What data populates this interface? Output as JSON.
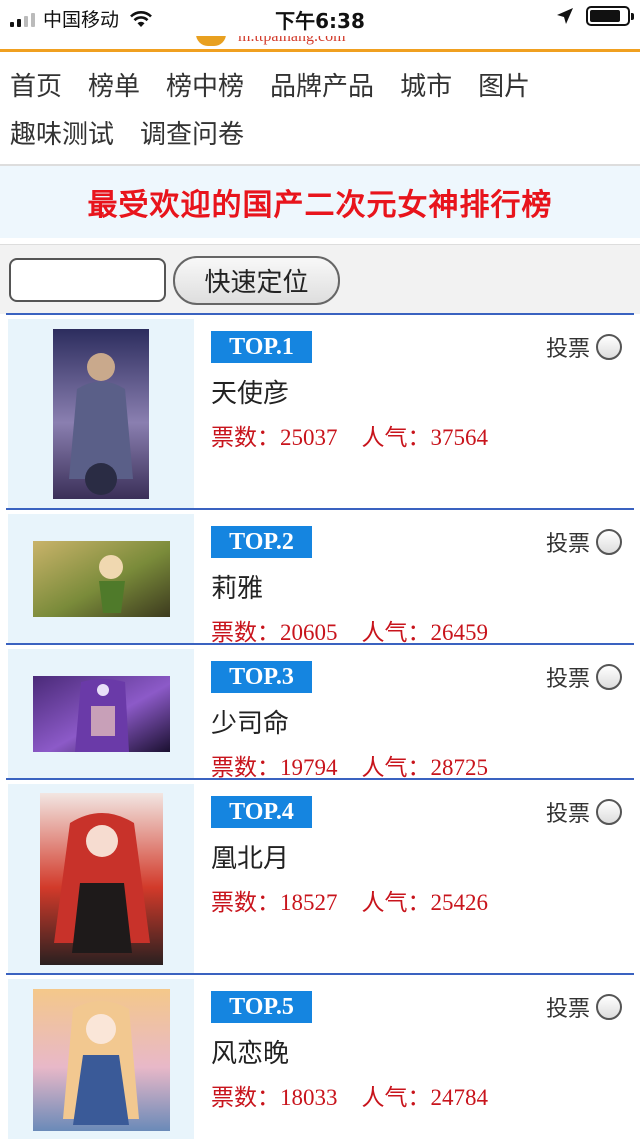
{
  "status_bar": {
    "carrier": "中国移动",
    "time": "下午6:38"
  },
  "header": {
    "logo_text": "m.ttpaihang.com"
  },
  "nav": {
    "row1": [
      "首页",
      "榜单",
      "榜中榜",
      "品牌产品",
      "城市",
      "图片"
    ],
    "row2": [
      "趣味测试",
      "调查问卷"
    ]
  },
  "page_title": "最受欢迎的国产二次元女神排行榜",
  "search": {
    "value": "",
    "button_label": "快速定位"
  },
  "vote_label": "投票",
  "votes_label": "票数：",
  "popularity_label": "人气：",
  "items": [
    {
      "rank": "TOP.1",
      "name": "天使彦",
      "votes": "25037",
      "popularity": "37564",
      "thumb_colors": [
        "#2c2d5e",
        "#8a7fb0",
        "#3a2f58"
      ]
    },
    {
      "rank": "TOP.2",
      "name": "莉雅",
      "votes": "20605",
      "popularity": "26459",
      "thumb_colors": [
        "#c9b36a",
        "#7a8b3a",
        "#3c3a1e"
      ]
    },
    {
      "rank": "TOP.3",
      "name": "少司命",
      "votes": "19794",
      "popularity": "28725",
      "thumb_colors": [
        "#4a2a78",
        "#8c5ac8",
        "#1a1030"
      ]
    },
    {
      "rank": "TOP.4",
      "name": "凰北月",
      "votes": "18527",
      "popularity": "25426",
      "thumb_colors": [
        "#f2e6e2",
        "#d23a2a",
        "#2a2020"
      ]
    },
    {
      "rank": "TOP.5",
      "name": "风恋晚",
      "votes": "18033",
      "popularity": "24784",
      "thumb_colors": [
        "#f4c88a",
        "#e8b8c8",
        "#6a8ab8"
      ]
    }
  ]
}
